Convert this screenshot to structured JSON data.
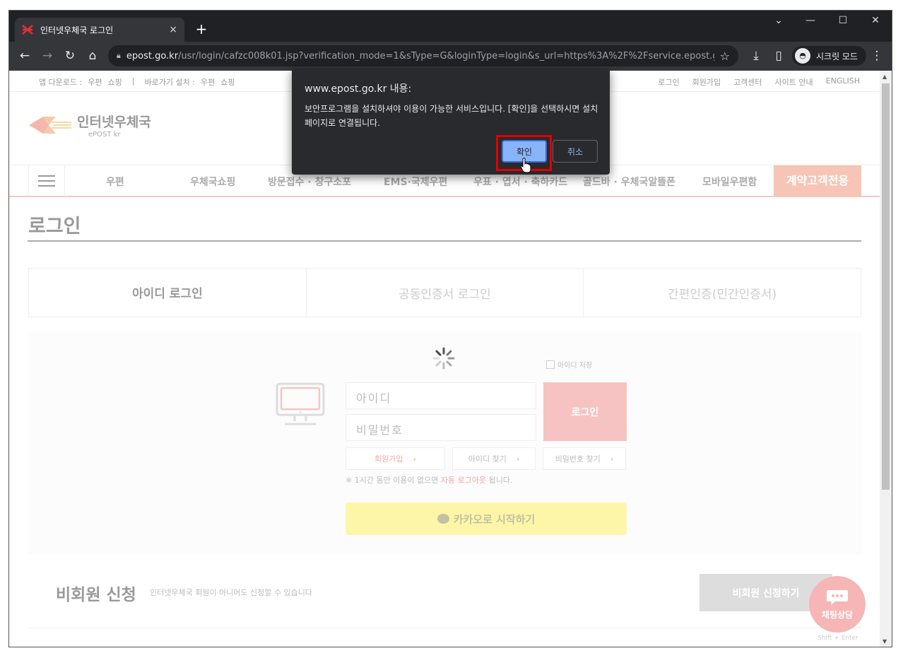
{
  "browser": {
    "tab_title": "인터넷우체국 로그인",
    "tab_close": "×",
    "new_tab": "+",
    "url_host": "epost.go.kr",
    "url_path": "/usr/login/cafzc008k01.jsp?verification_mode=1&sType=G&loginType=login&s_url=https%3A%2F%2Fservice.epost.g...",
    "incognito_label": "시크릿 모드",
    "window_controls": {
      "minimize": "—",
      "maximize": "☐",
      "close": "✕",
      "dropdown": "⌄"
    },
    "nav": {
      "back": "←",
      "forward": "→",
      "reload": "↻",
      "home": "⌂",
      "star": "☆",
      "download": "⤓",
      "sidepanel": "▯",
      "menu": "⋮"
    }
  },
  "util": {
    "left": [
      "앱 다운로드 :",
      "우편",
      "쇼핑",
      "바로가기 설치 :",
      "우편",
      "쇼핑"
    ],
    "right": [
      "로그인",
      "회원가입",
      "고객센터",
      "사이트 안내",
      "ENGLISH"
    ]
  },
  "logo": {
    "name": "인터넷우체국",
    "sub": "ePOST kr"
  },
  "gnb": {
    "items": [
      "우편",
      "우체국쇼핑",
      "방문접수 · 창구소포",
      "EMS·국제우편",
      "우표 · 엽서 · 축하카드",
      "골드바 · 우체국알뜰폰",
      "모바일우편함"
    ],
    "special": "계약고객전용"
  },
  "page_title": "로그인",
  "login_tabs": [
    "아이디 로그인",
    "공동인증서 로그인",
    "간편인증(민간인증서)"
  ],
  "form": {
    "save_id": "아이디 저장",
    "id_placeholder": "아이디",
    "pw_placeholder": "비밀번호",
    "login_button": "로그인",
    "join": "회원가입",
    "find_id": "아이디 찾기",
    "find_pw": "비밀번호 찾기",
    "notice_before": "※ 1시간 동안 이용이 없으면 ",
    "notice_red": "자동 로그아웃",
    "notice_after": " 됩니다.",
    "kakao": "카카오로 시작하기"
  },
  "guest": {
    "title": "비회원 신청",
    "desc": "인터넷우체국 회원이 아니어도 신청할 수 있습니다",
    "button": "비회원 신청하기"
  },
  "chat": {
    "label": "채팅상담",
    "hint": "Shift + Enter"
  },
  "dialog": {
    "title": "www.epost.go.kr 내용:",
    "message": "보안프로그램을 설치하셔야 이용이 가능한 서비스입니다. [확인]을 선택하시면 설치페이지로 연결됩니다.",
    "ok": "확인",
    "cancel": "취소"
  },
  "colors": {
    "accent": "#f7c3c2",
    "highlight_frame": "#e00000",
    "dialog_bg": "#292a2d"
  }
}
